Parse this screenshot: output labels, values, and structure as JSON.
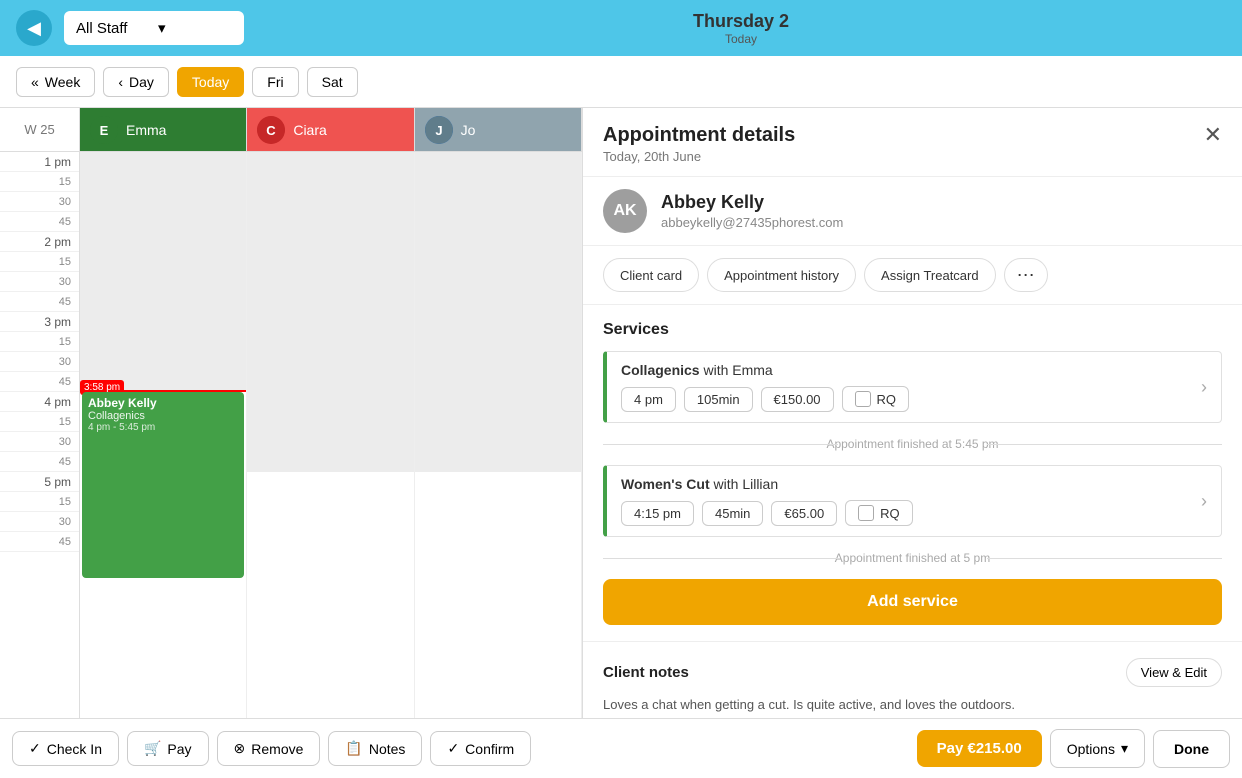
{
  "topbar": {
    "back_icon": "◀",
    "staff_label": "All Staff",
    "dropdown_icon": "▾",
    "date_display": "Thursday 2",
    "date_sub": "Today"
  },
  "navbar": {
    "week_btn": "Week",
    "day_btn": "Day",
    "today_btn": "Today",
    "fri_btn": "Fri",
    "sat_btn": "Sat"
  },
  "calendar": {
    "week_label": "W 25",
    "staff": [
      {
        "name": "Emma",
        "initials": "E",
        "color_class": "emma"
      },
      {
        "name": "Ciara",
        "initials": "C",
        "color_class": "ciara"
      },
      {
        "name": "Jo",
        "initials": "J",
        "color_class": "jo"
      }
    ],
    "current_time": "3:58 pm",
    "appointment": {
      "client": "Abbey Kelly",
      "service": "Collagenics",
      "time_range": "4 pm - 5:45 pm"
    }
  },
  "panel": {
    "title": "Appointment details",
    "subtitle": "Today, 20th June",
    "close_icon": "✕",
    "client": {
      "initials": "AK",
      "name": "Abbey Kelly",
      "email": "abbeykelly@27435phorest.com"
    },
    "action_buttons": [
      {
        "label": "Client card",
        "key": "client-card"
      },
      {
        "label": "Appointment history",
        "key": "appointment-history"
      },
      {
        "label": "Assign Treatcard",
        "key": "assign-treatcard"
      },
      {
        "label": "⋯",
        "key": "more-options"
      }
    ],
    "services_title": "Services",
    "services": [
      {
        "name_bold": "Collagenics",
        "name_rest": " with Emma",
        "time": "4 pm",
        "duration": "105min",
        "price": "€150.00",
        "rq": "RQ",
        "finished_at": "Appointment finished at 5:45 pm"
      },
      {
        "name_bold": "Women's Cut",
        "name_rest": " with Lillian",
        "time": "4:15 pm",
        "duration": "45min",
        "price": "€65.00",
        "rq": "RQ",
        "finished_at": "Appointment finished at 5 pm"
      }
    ],
    "add_service_label": "Add service",
    "client_notes_title": "Client notes",
    "client_notes_text": "Loves a chat when getting a cut. Is quite active, and loves the outdoors.",
    "view_edit_label": "View & Edit"
  },
  "bottombar": {
    "checkin_label": "Check In",
    "pay_label": "Pay",
    "remove_label": "Remove",
    "notes_label": "Notes",
    "confirm_label": "Confirm",
    "pay_amount_label": "Pay €215.00",
    "options_label": "Options",
    "options_icon": "▾",
    "done_label": "Done"
  }
}
